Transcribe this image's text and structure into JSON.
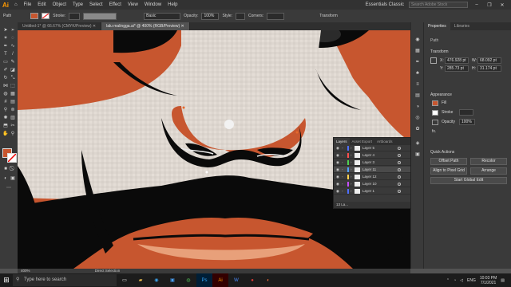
{
  "app": {
    "logo": "Ai"
  },
  "menu": [
    "File",
    "Edit",
    "Object",
    "Type",
    "Select",
    "Effect",
    "View",
    "Window",
    "Help"
  ],
  "workspace": "Essentials Classic",
  "search_placeholder": "Search Adobe Stock",
  "window_buttons": [
    "–",
    "❐",
    "✕"
  ],
  "control": {
    "selection": "Path",
    "stroke_label": "Stroke:",
    "brush": "Basic",
    "opacity_label": "Opacity:",
    "opacity_value": "100%",
    "style_label": "Style:",
    "corners_label": "Corners:",
    "transform_label": "Transform"
  },
  "tabs": [
    {
      "label": "Untitled-1* @ 66.67% (CMYK/Preview)",
      "close": "✕"
    },
    {
      "label": "lalu malingga.ai* @ 400% (RGB/Preview)",
      "close": "✕"
    }
  ],
  "properties": {
    "tabs": [
      "Properties",
      "Libraries"
    ],
    "path_label": "Path",
    "transform_title": "Transform",
    "x_label": "X:",
    "x_value": "476.928 pt",
    "y_label": "Y:",
    "y_value": "285.73 pt",
    "w_label": "W:",
    "w_value": "68.092 pt",
    "h_label": "H:",
    "h_value": "31.174 pt",
    "appearance_title": "Appearance",
    "fill_label": "Fill",
    "stroke_label": "Stroke",
    "opacity_label": "Opacity",
    "opacity_value": "100%",
    "fx_label": "fx.",
    "quick_actions_title": "Quick Actions",
    "offset_path": "Offset Path",
    "recolor": "Recolor",
    "align_pixel_grid": "Align to Pixel Grid",
    "arrange": "Arrange",
    "start_global_edit": "Start Global Edit"
  },
  "layers_panel": {
    "tabs": [
      "Layers",
      "Asset Export",
      "Artboards"
    ],
    "layers": [
      {
        "name": "Layer 5",
        "color": "#4f6fff"
      },
      {
        "name": "Layer 4",
        "color": "#ff4f4f"
      },
      {
        "name": "Layer 3",
        "color": "#4fd24f"
      },
      {
        "name": "Layer 11",
        "color": "#4f9fff"
      },
      {
        "name": "Layer 12",
        "color": "#ffd24f"
      },
      {
        "name": "Layer 10",
        "color": "#c44fff"
      },
      {
        "name": "Layer 1",
        "color": "#4f6fff"
      }
    ],
    "footer": "13 La..."
  },
  "status": {
    "zoom": "400%",
    "tool": "Direct Selection"
  },
  "taskbar": {
    "search_placeholder": "Type here to search",
    "apps": [
      "⊞",
      "📁",
      "🌐",
      "Ps",
      "Ai",
      "W",
      "●"
    ],
    "lang": "ENG",
    "time": "10:03 PM",
    "date": "7/1/2021"
  },
  "colors": {
    "accent": "#ff9a00",
    "skin_dark": "#c7562f",
    "skin_light": "#e0d9d2",
    "hair": "#0a0a0a"
  }
}
